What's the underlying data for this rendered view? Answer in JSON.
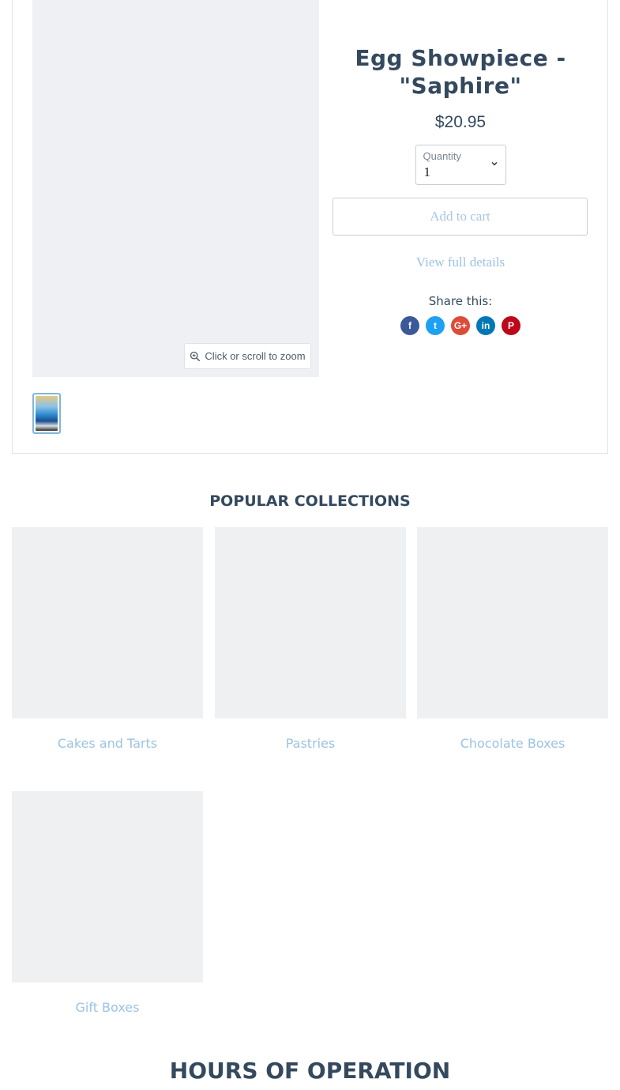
{
  "product": {
    "title": "Egg Showpiece - \"Saphire\"",
    "price": "$20.95",
    "quantity": {
      "label": "Quantity",
      "value": "1"
    },
    "add_to_cart_label": "Add to cart",
    "view_details_label": "View full details",
    "share_label": "Share this:",
    "zoom_label": "Click or scroll to zoom",
    "share_icons": [
      {
        "icon": "facebook-icon",
        "glyph": "f",
        "color": "#3b5998"
      },
      {
        "icon": "twitter-icon",
        "glyph": "t",
        "color": "#1da1f2"
      },
      {
        "icon": "google-plus-icon",
        "glyph": "G+",
        "color": "#dd4b39"
      },
      {
        "icon": "linkedin-icon",
        "glyph": "in",
        "color": "#0077b5"
      },
      {
        "icon": "pinterest-icon",
        "glyph": "P",
        "color": "#bd081c"
      }
    ]
  },
  "popular": {
    "title": "POPULAR COLLECTIONS",
    "collections": [
      {
        "label": "Cakes and Tarts"
      },
      {
        "label": "Pastries"
      },
      {
        "label": "Chocolate Boxes"
      },
      {
        "label": "Gift Boxes"
      }
    ]
  },
  "hours": {
    "title": "HOURS OF OPERATION"
  },
  "colors": {
    "link": "#9cc3e2",
    "heading": "#34495e",
    "placeholder": "#eff0f2"
  }
}
